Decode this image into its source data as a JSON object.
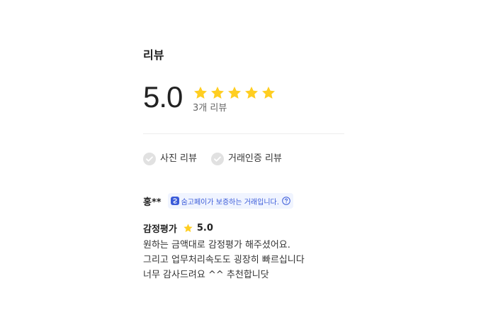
{
  "review_section": {
    "title": "리뷰",
    "summary": {
      "score": "5.0",
      "stars_filled": 5,
      "stars_total": 5,
      "review_count": "3개 리뷰"
    },
    "filters": [
      {
        "label": "사진 리뷰",
        "icon": "check-circle-icon"
      },
      {
        "label": "거래인증 리뷰",
        "icon": "check-circle-icon"
      }
    ],
    "reviews": [
      {
        "reviewer": "홍**",
        "badge": {
          "text": "숨고페이가 보증하는 거래입니다.",
          "icon": "soomgo-pay-icon",
          "help_icon": "question-circle-icon"
        },
        "category": "감정평가",
        "rating": "5.0",
        "body": "원하는 금액대로 감정평가 해주셨어요.\n그리고 업무처리속도도 굉장히 빠르십니다\n너무 감사드려요 ^^ 추천합니닷"
      }
    ]
  },
  "colors": {
    "star": "#FFCE21",
    "check_gray": "#E1E1E1",
    "badge_bg": "#F0F4FF",
    "badge_text": "#3A5BD9",
    "divider": "#ECECEC"
  }
}
